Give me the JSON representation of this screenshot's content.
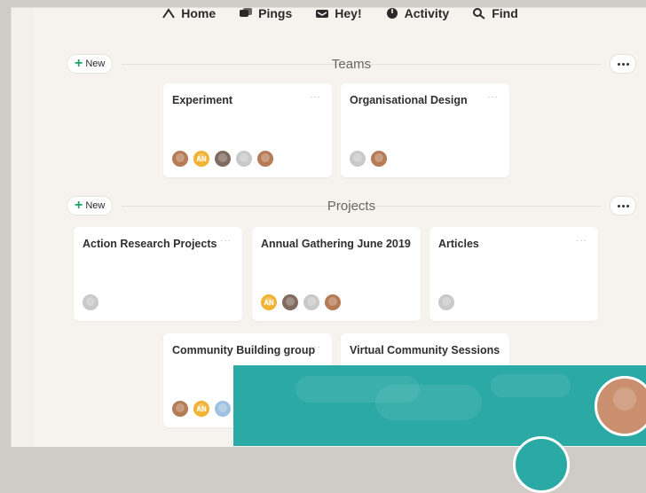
{
  "nav": {
    "items": [
      {
        "label": "Home",
        "icon": "home-icon"
      },
      {
        "label": "Pings",
        "icon": "pings-icon"
      },
      {
        "label": "Hey!",
        "icon": "hey-icon"
      },
      {
        "label": "Activity",
        "icon": "activity-icon"
      },
      {
        "label": "Find",
        "icon": "find-icon"
      }
    ]
  },
  "teams": {
    "title": "Teams",
    "new_label": "New",
    "cards": [
      {
        "title": "Experiment",
        "avatars": [
          "avatar",
          "AN",
          "avatar",
          "avatar",
          "avatar"
        ]
      },
      {
        "title": "Organisational Design",
        "avatars": [
          "avatar",
          "avatar"
        ]
      }
    ]
  },
  "projects": {
    "title": "Projects",
    "new_label": "New",
    "cards": [
      {
        "title": "Action Research Projects",
        "avatars": [
          "avatar"
        ]
      },
      {
        "title": "Annual Gathering June 2019",
        "avatars": [
          "AN",
          "avatar",
          "avatar",
          "avatar"
        ]
      },
      {
        "title": "Articles",
        "avatars": [
          "avatar"
        ]
      },
      {
        "title": "Community Building group",
        "avatars": [
          "avatar",
          "AN",
          "avatar",
          "avatar"
        ]
      },
      {
        "title": "Virtual Community Sessions",
        "avatars": []
      }
    ]
  },
  "colors": {
    "accent_green": "#1fa36a",
    "overlay_teal": "#2aa9a5",
    "avatar_an": "#f2b233"
  }
}
